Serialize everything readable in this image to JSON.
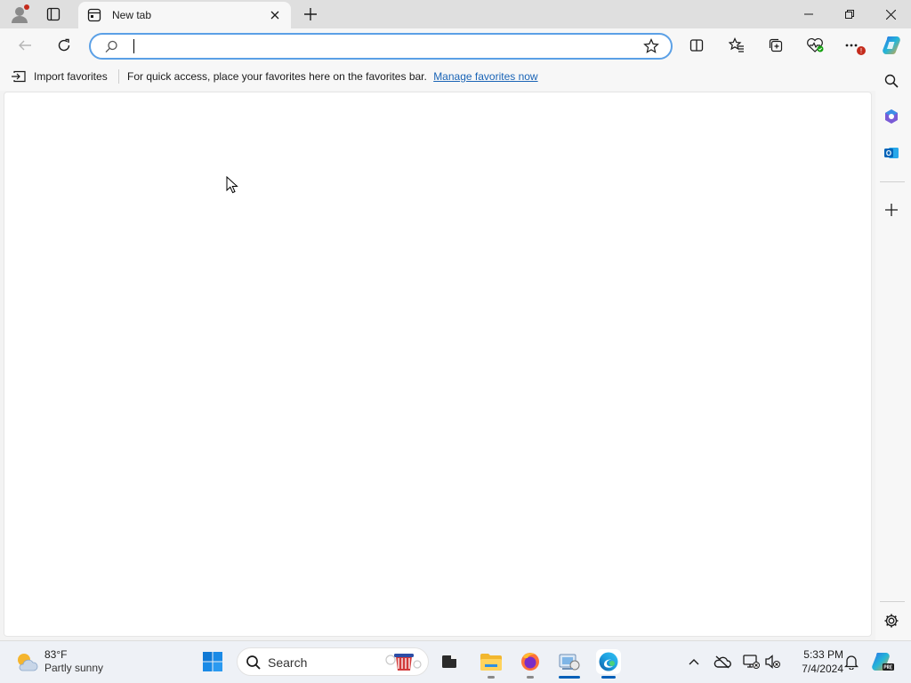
{
  "browser": {
    "tab": {
      "title": "New tab"
    },
    "address_bar": {
      "value": "",
      "placeholder": ""
    },
    "favorites_bar": {
      "import_label": "Import favorites",
      "message": "For quick access, place your favorites here on the favorites bar.",
      "manage_link": "Manage favorites now"
    }
  },
  "taskbar": {
    "weather": {
      "temperature": "83°F",
      "condition": "Partly sunny"
    },
    "search_label": "Search",
    "clock": {
      "time": "5:33 PM",
      "date": "7/4/2024"
    }
  },
  "colors": {
    "accent": "#005fb8",
    "link": "#1a64b6",
    "omnibox_border": "#5ba0e6",
    "notification_badge": "#c42b1c"
  },
  "icons": [
    "profile-icon",
    "tab-actions-icon",
    "new-tab-page-icon",
    "close-tab-icon",
    "new-tab-icon",
    "minimize-icon",
    "restore-icon",
    "close-window-icon",
    "back-icon",
    "refresh-icon",
    "search-icon",
    "favorite-star-icon",
    "split-screen-icon",
    "favorites-icon",
    "collections-icon",
    "browser-essentials-icon",
    "more-icon",
    "copilot-icon",
    "import-favorites-icon",
    "sidebar-search-icon",
    "microsoft365-icon",
    "outlook-icon",
    "add-icon",
    "settings-icon",
    "weather-icon",
    "start-icon",
    "file-explorer-icon",
    "firefox-icon",
    "edge-icon",
    "notifications-icon",
    "onedrive-icon"
  ]
}
